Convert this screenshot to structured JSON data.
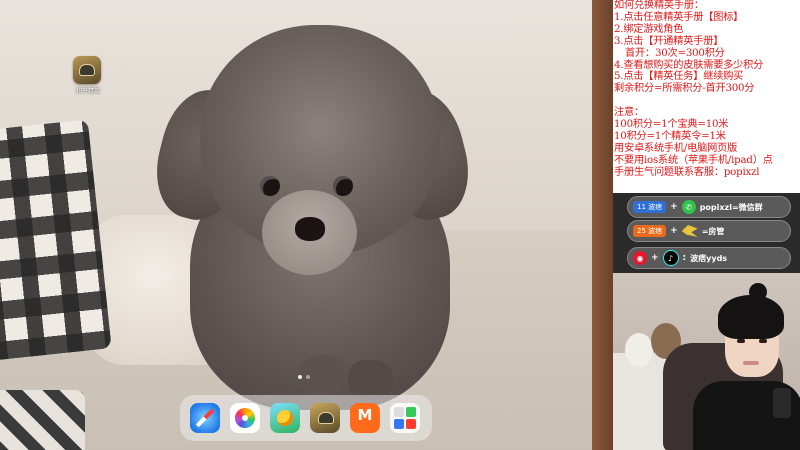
{
  "ipad": {
    "top_app": {
      "name": "PUBG Mobile",
      "label": "和平精英",
      "icon": "pubg-icon"
    },
    "page_indicator": {
      "pages": 2,
      "current": 1
    },
    "dock_apps": [
      {
        "name": "Safari",
        "icon": "safari-icon"
      },
      {
        "name": "Photos",
        "icon": "photos-icon"
      },
      {
        "name": "Game",
        "icon": "game-icon"
      },
      {
        "name": "PUBG Mobile",
        "icon": "pubg-icon"
      },
      {
        "name": "MGTV",
        "icon": "mgtv-icon"
      },
      {
        "name": "Folder",
        "icon": "folder-icon"
      }
    ]
  },
  "notice": {
    "lines": [
      "如何兑换精英手册：",
      "1.点击任意精英手册【图标】",
      "2.绑定游戏角色",
      "3.点击【开通精英手册】",
      "   首开：30次=300积分",
      "4.查看想购买的皮肤需要多少积分",
      "5.点击【精英任务】继续购买",
      "剩余积分=所需积分-首开300分",
      "",
      "注意：",
      "100积分=1个宝典=10米",
      "10积分=1个精英令=1米",
      "用安卓系统手机/电脑网页版",
      "不要用ios系统（苹果手机/ipad）点",
      "手册生气问题联系客服：popixzl"
    ],
    "color": "#e01818"
  },
  "socials": {
    "row1": {
      "tag": "11 波痞",
      "text": "popixzl=微信群",
      "icon": "wechat-icon"
    },
    "row2": {
      "tag": "25 波痞",
      "text": "=房管",
      "icon": "bird-icon"
    },
    "row3": {
      "text": "波痞yyds",
      "icons": [
        "weibo-icon",
        "douyin-icon"
      ]
    }
  },
  "colors": {
    "tag_blue": "#2f6fd6",
    "tag_orange": "#e86a1a",
    "wechat": "#2ec24a",
    "weibo": "#e6162d"
  }
}
